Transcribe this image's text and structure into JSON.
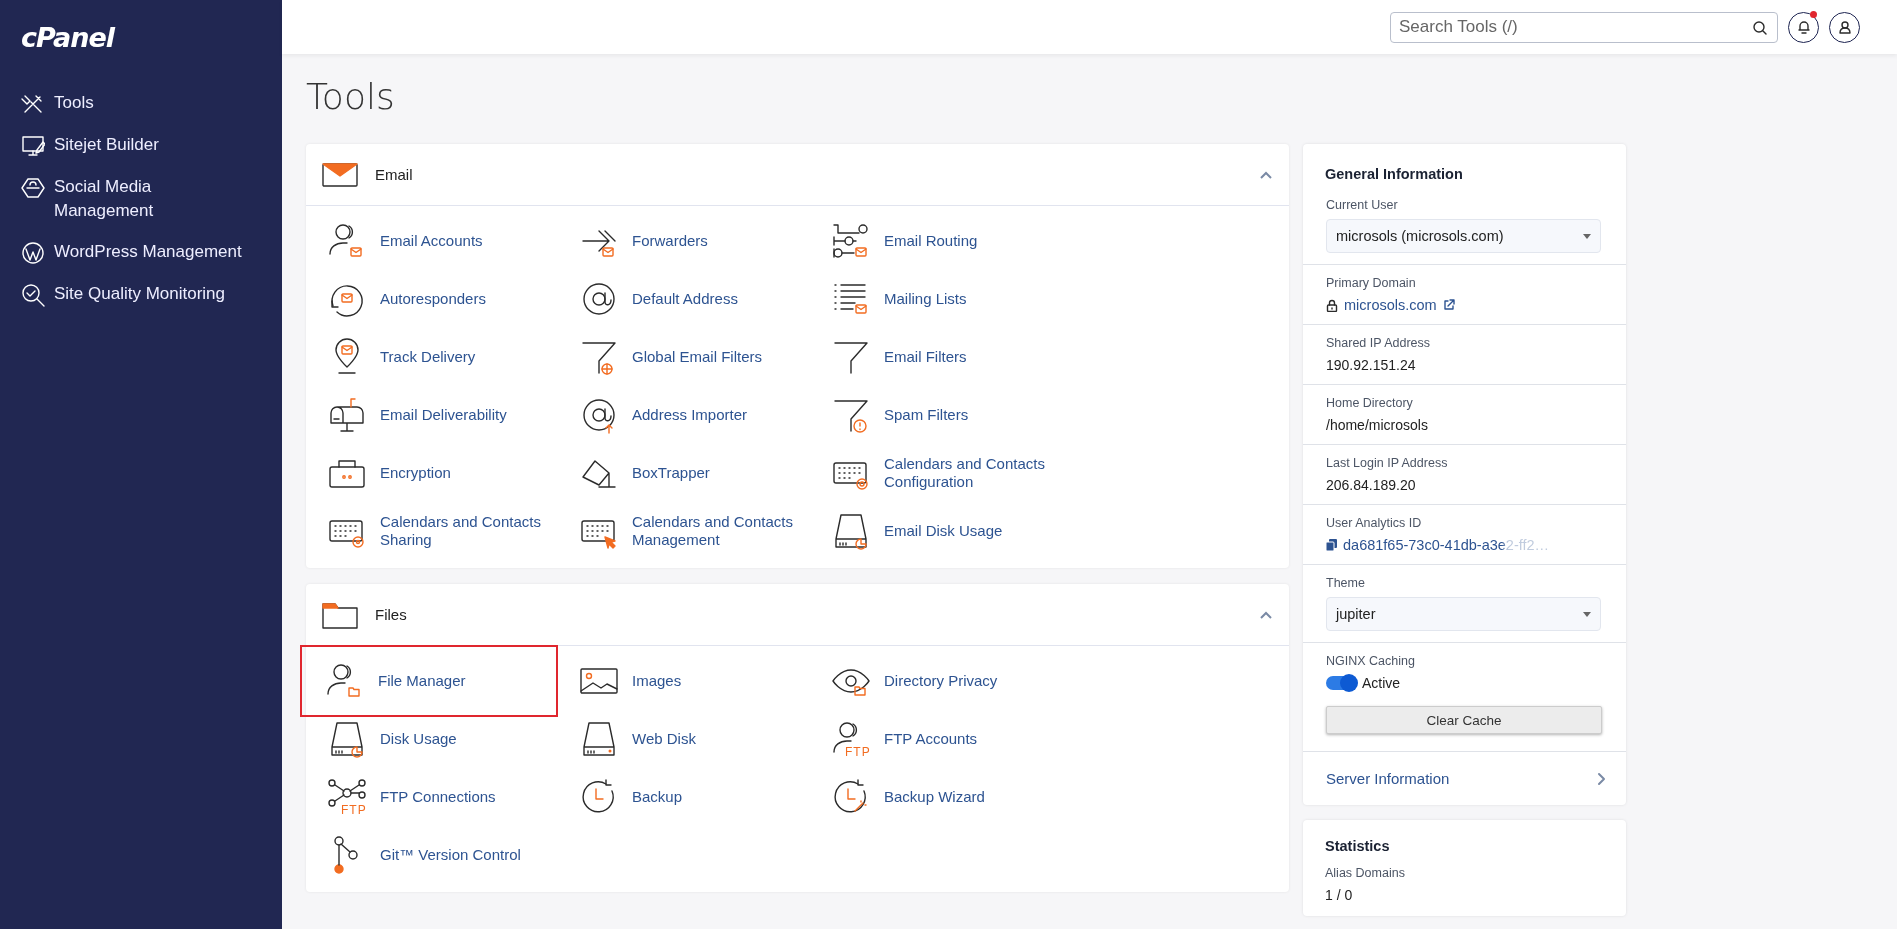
{
  "sidebar": {
    "logo": "cPanel",
    "items": [
      {
        "label": "Tools"
      },
      {
        "label": "Sitejet Builder"
      },
      {
        "label": "Social Media Management"
      },
      {
        "label": "WordPress Management"
      },
      {
        "label": "Site Quality Monitoring"
      }
    ]
  },
  "header": {
    "search": {
      "placeholder": "Search Tools (/)"
    },
    "notifications": {
      "unread": true
    }
  },
  "page_title": "Tools",
  "sections": [
    {
      "title": "Email",
      "expanded": true,
      "items": [
        {
          "label": "Email Accounts",
          "highlighted": false
        },
        {
          "label": "Forwarders",
          "highlighted": false
        },
        {
          "label": "Email Routing",
          "highlighted": false
        },
        {
          "label": "Autoresponders",
          "highlighted": false
        },
        {
          "label": "Default Address",
          "highlighted": false
        },
        {
          "label": "Mailing Lists",
          "highlighted": false
        },
        {
          "label": "Track Delivery",
          "highlighted": false
        },
        {
          "label": "Global Email Filters",
          "highlighted": false
        },
        {
          "label": "Email Filters",
          "highlighted": false
        },
        {
          "label": "Email Deliverability",
          "highlighted": false
        },
        {
          "label": "Address Importer",
          "highlighted": false
        },
        {
          "label": "Spam Filters",
          "highlighted": false
        },
        {
          "label": "Encryption",
          "highlighted": false
        },
        {
          "label": "BoxTrapper",
          "highlighted": false
        },
        {
          "label": "Calendars and Contacts Configuration",
          "highlighted": false
        },
        {
          "label": "Calendars and Contacts Sharing",
          "highlighted": false
        },
        {
          "label": "Calendars and Contacts Management",
          "highlighted": false
        },
        {
          "label": "Email Disk Usage",
          "highlighted": false
        }
      ]
    },
    {
      "title": "Files",
      "expanded": true,
      "items": [
        {
          "label": "File Manager",
          "highlighted": true
        },
        {
          "label": "Images",
          "highlighted": false
        },
        {
          "label": "Directory Privacy",
          "highlighted": false
        },
        {
          "label": "Disk Usage",
          "highlighted": false
        },
        {
          "label": "Web Disk",
          "highlighted": false
        },
        {
          "label": "FTP Accounts",
          "highlighted": false,
          "icon_text": "FTP"
        },
        {
          "label": "FTP Connections",
          "highlighted": false,
          "icon_text": "FTP"
        },
        {
          "label": "Backup",
          "highlighted": false
        },
        {
          "label": "Backup Wizard",
          "highlighted": false
        },
        {
          "label": "Git™ Version Control",
          "highlighted": false
        }
      ]
    }
  ],
  "general_information": {
    "title": "General Information",
    "fields": [
      {
        "kind": "select",
        "label": "Current User",
        "value": "microsols (microsols.com)"
      },
      {
        "kind": "link",
        "label": "Primary Domain",
        "value": "microsols.com"
      },
      {
        "kind": "text",
        "label": "Shared IP Address",
        "value": "190.92.151.24"
      },
      {
        "kind": "text",
        "label": "Home Directory",
        "value": "/home/microsols"
      },
      {
        "kind": "text",
        "label": "Last Login IP Address",
        "value": "206.84.189.20"
      },
      {
        "kind": "copy",
        "label": "User Analytics ID",
        "value": "da681f65-73c0-41db-a3e2-ff2…"
      },
      {
        "kind": "select",
        "label": "Theme",
        "value": "jupiter"
      },
      {
        "kind": "toggle",
        "label": "NGINX Caching",
        "on": true,
        "value": "Active",
        "button": "Clear Cache"
      }
    ],
    "link": "Server Information"
  },
  "statistics": {
    "title": "Statistics",
    "fields": [
      {
        "label": "Alias Domains",
        "value": "1 / 0"
      }
    ]
  }
}
